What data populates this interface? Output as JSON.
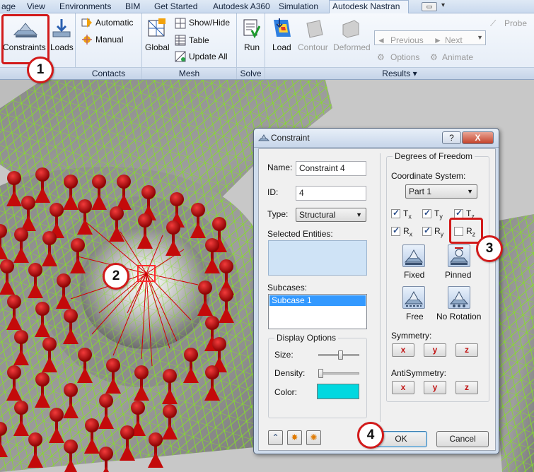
{
  "tabs": [
    "age",
    "View",
    "Environments",
    "BIM",
    "Get Started",
    "Autodesk A360",
    "Simulation",
    "Autodesk Nastran"
  ],
  "active_tab": "Autodesk Nastran",
  "ribbon": {
    "constraints_label": "Constraints",
    "loads_label": "Loads",
    "contacts": {
      "automatic": "Automatic",
      "manual": "Manual",
      "title": "Contacts"
    },
    "mesh": {
      "global": "Global",
      "show_hide": "Show/Hide",
      "table": "Table",
      "update_all": "Update  All",
      "title": "Mesh"
    },
    "solve": {
      "run": "Run",
      "title": "Solve"
    },
    "results": {
      "load": "Load",
      "contour": "Contour",
      "deformed": "Deformed",
      "previous": "Previous",
      "next": "Next",
      "options": "Options",
      "animate": "Animate",
      "probe": "Probe",
      "title": "Results",
      "title_arrow": "▾"
    }
  },
  "callouts": [
    "1",
    "2",
    "3",
    "4"
  ],
  "dialog": {
    "title": "Constraint",
    "help": "?",
    "close": "X",
    "name_label": "Name:",
    "name_value": "Constraint 4",
    "id_label": "ID:",
    "id_value": "4",
    "type_label": "Type:",
    "type_value": "Structural",
    "selected_entities_label": "Selected Entities:",
    "subcases_label": "Subcases:",
    "subcases": [
      "Subcase 1"
    ],
    "display_options": {
      "title": "Display Options",
      "size_label": "Size:",
      "size_level": 0.55,
      "density_label": "Density:",
      "density_level": 0.0,
      "color_label": "Color:",
      "color_value": "#00d8e0"
    },
    "dof": {
      "title": "Degrees of Freedom",
      "coord_label": "Coordinate System:",
      "coord_value": "Part 1",
      "items": [
        {
          "letter": "T",
          "sub": "x",
          "checked": true
        },
        {
          "letter": "T",
          "sub": "y",
          "checked": true
        },
        {
          "letter": "T",
          "sub": "z",
          "checked": true
        },
        {
          "letter": "R",
          "sub": "x",
          "checked": true
        },
        {
          "letter": "R",
          "sub": "y",
          "checked": true
        },
        {
          "letter": "R",
          "sub": "z",
          "checked": false
        }
      ],
      "presets": [
        "Fixed",
        "Pinned",
        "Free",
        "No Rotation"
      ]
    },
    "symmetry_label": "Symmetry:",
    "antisymmetry_label": "AntiSymmetry:",
    "axis_buttons": [
      "x",
      "y",
      "z"
    ],
    "ok": "OK",
    "cancel": "Cancel"
  },
  "colors": {
    "accent_red": "#d21a1a",
    "mesh_green": "#7ed321",
    "arrow_red": "#c40a0a"
  }
}
